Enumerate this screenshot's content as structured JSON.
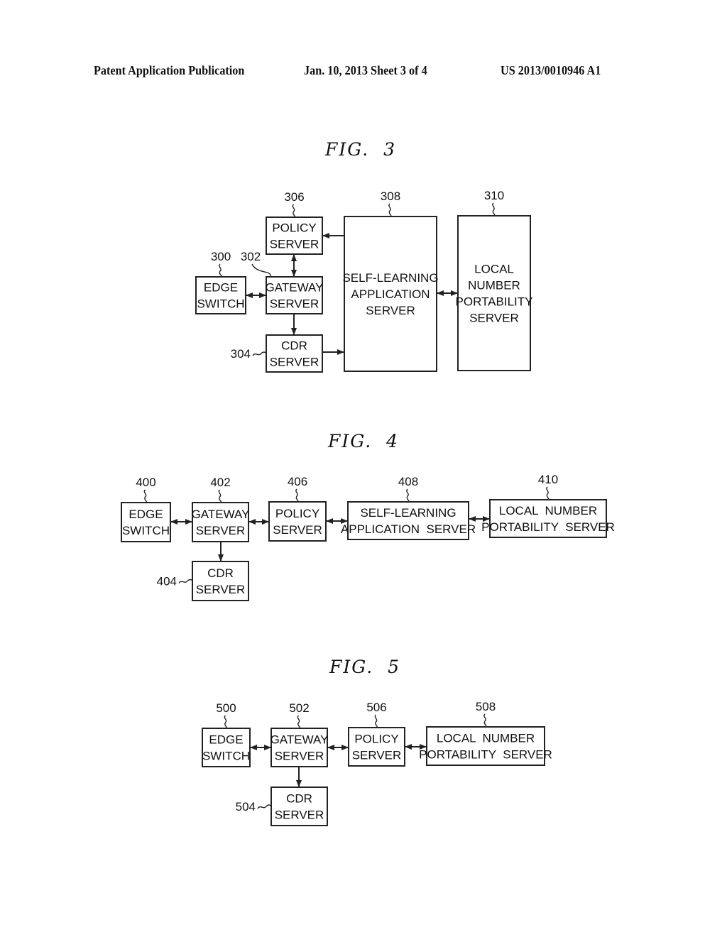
{
  "header": {
    "publication": "Patent Application Publication",
    "date_sheet": "Jan. 10, 2013   Sheet 3 of 4",
    "patent_number": "US 2013/0010946 A1"
  },
  "figures": [
    {
      "title": "FIG.  3",
      "nodes": [
        {
          "ref": "300",
          "lines": [
            "EDGE",
            "SWITCH"
          ]
        },
        {
          "ref": "302",
          "lines": [
            "GATEWAY",
            "SERVER"
          ]
        },
        {
          "ref": "304",
          "lines": [
            "CDR",
            "SERVER"
          ]
        },
        {
          "ref": "306",
          "lines": [
            "POLICY",
            "SERVER"
          ]
        },
        {
          "ref": "308",
          "lines": [
            "SELF-LEARNING",
            "APPLICATION",
            "SERVER"
          ]
        },
        {
          "ref": "310",
          "lines": [
            "LOCAL",
            "NUMBER",
            "PORTABILITY",
            "SERVER"
          ]
        }
      ],
      "edges": [
        {
          "from": "300",
          "to": "302",
          "direction": "both"
        },
        {
          "from": "302",
          "to": "306",
          "direction": "both"
        },
        {
          "from": "302",
          "to": "304",
          "direction": "forward"
        },
        {
          "from": "308",
          "to": "306",
          "direction": "forward"
        },
        {
          "from": "304",
          "to": "308",
          "direction": "forward"
        },
        {
          "from": "308",
          "to": "310",
          "direction": "both"
        }
      ]
    },
    {
      "title": "FIG.  4",
      "nodes": [
        {
          "ref": "400",
          "lines": [
            "EDGE",
            "SWITCH"
          ]
        },
        {
          "ref": "402",
          "lines": [
            "GATEWAY",
            "SERVER"
          ]
        },
        {
          "ref": "404",
          "lines": [
            "CDR",
            "SERVER"
          ]
        },
        {
          "ref": "406",
          "lines": [
            "POLICY",
            "SERVER"
          ]
        },
        {
          "ref": "408",
          "lines": [
            "SELF-LEARNING",
            "APPLICATION  SERVER"
          ]
        },
        {
          "ref": "410",
          "lines": [
            "LOCAL  NUMBER",
            "PORTABILITY  SERVER"
          ]
        }
      ],
      "edges": [
        {
          "from": "400",
          "to": "402",
          "direction": "both"
        },
        {
          "from": "402",
          "to": "406",
          "direction": "both"
        },
        {
          "from": "402",
          "to": "404",
          "direction": "forward"
        },
        {
          "from": "406",
          "to": "408",
          "direction": "both"
        },
        {
          "from": "408",
          "to": "410",
          "direction": "both"
        }
      ]
    },
    {
      "title": "FIG.  5",
      "nodes": [
        {
          "ref": "500",
          "lines": [
            "EDGE",
            "SWITCH"
          ]
        },
        {
          "ref": "502",
          "lines": [
            "GATEWAY",
            "SERVER"
          ]
        },
        {
          "ref": "504",
          "lines": [
            "CDR",
            "SERVER"
          ]
        },
        {
          "ref": "506",
          "lines": [
            "POLICY",
            "SERVER"
          ]
        },
        {
          "ref": "508",
          "lines": [
            "LOCAL  NUMBER",
            "PORTABILITY  SERVER"
          ]
        }
      ],
      "edges": [
        {
          "from": "500",
          "to": "502",
          "direction": "both"
        },
        {
          "from": "502",
          "to": "506",
          "direction": "both"
        },
        {
          "from": "502",
          "to": "504",
          "direction": "forward"
        },
        {
          "from": "506",
          "to": "508",
          "direction": "both"
        }
      ]
    }
  ]
}
